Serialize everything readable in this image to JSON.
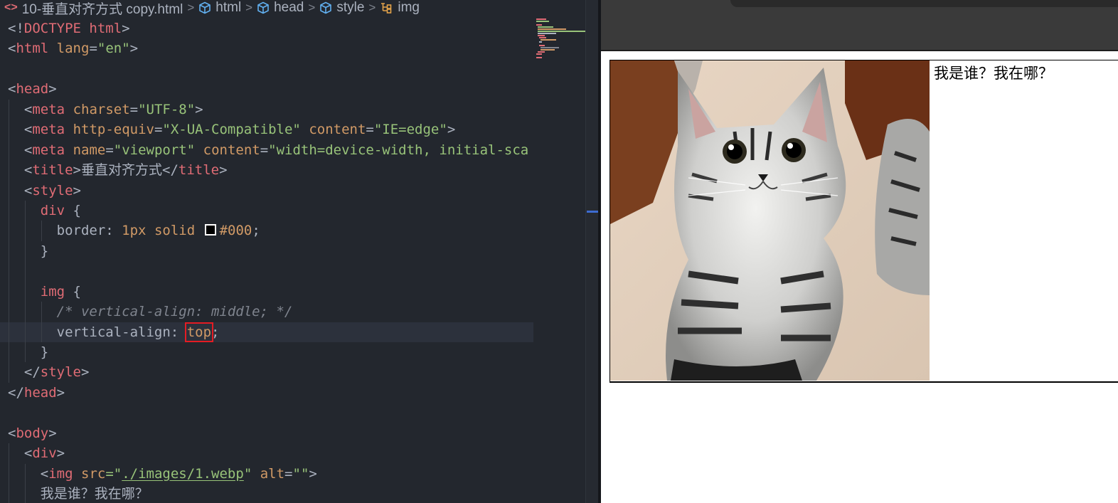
{
  "editor": {
    "breadcrumb": {
      "file_icon": "<>",
      "file": "10-垂直对齐方式 copy.html",
      "items": [
        "html",
        "head",
        "style",
        "img"
      ],
      "separator": ">"
    },
    "lines": {
      "l1": {
        "a": "<!",
        "b": "DOCTYPE",
        "c": " html",
        "d": ">"
      },
      "l2": {
        "a": "<",
        "b": "html",
        "c": "lang",
        "d": "=",
        "e": "\"en\"",
        "f": ">"
      },
      "l4": {
        "a": "<",
        "b": "head",
        "c": ">"
      },
      "l5": {
        "a": "<",
        "b": "meta",
        "c": "charset",
        "d": "=",
        "e": "\"UTF-8\"",
        "f": ">"
      },
      "l6": {
        "a": "<",
        "b": "meta",
        "c": "http-equiv",
        "d": "=",
        "e": "\"X-UA-Compatible\"",
        "f": "content",
        "g": "=",
        "h": "\"IE=edge\"",
        "i": ">"
      },
      "l7": {
        "a": "<",
        "b": "meta",
        "c": "name",
        "d": "=",
        "e": "\"viewport\"",
        "f": "content",
        "g": "=",
        "h": "\"width=device-width, initial-sca"
      },
      "l8": {
        "a": "<",
        "b": "title",
        "c": ">",
        "d": "垂直对齐方式",
        "e": "</",
        "f": "title",
        "g": ">"
      },
      "l9": {
        "a": "<",
        "b": "style",
        "c": ">"
      },
      "l10": {
        "a": "div",
        "b": " {"
      },
      "l11": {
        "a": "border",
        "b": ": ",
        "c": "1px",
        "d": " solid ",
        "e": "#000",
        "f": ";"
      },
      "l12": {
        "a": "}"
      },
      "l14": {
        "a": "img",
        "b": " {"
      },
      "l15": {
        "a": "/* vertical-align: middle; */"
      },
      "l16": {
        "a": "vertical-align",
        "b": ": ",
        "c": "top",
        "d": ";"
      },
      "l17": {
        "a": "}"
      },
      "l18": {
        "a": "</",
        "b": "style",
        "c": ">"
      },
      "l19": {
        "a": "</",
        "b": "head",
        "c": ">"
      },
      "l21": {
        "a": "<",
        "b": "body",
        "c": ">"
      },
      "l22": {
        "a": "<",
        "b": "div",
        "c": ">"
      },
      "l23": {
        "a": "<",
        "b": "img",
        "c": "src",
        "d": "=\"",
        "e": "./images/1.webp",
        "f": "\"",
        "g": "alt",
        "h": "=",
        "i": "\"\"",
        "j": ">"
      },
      "l24": {
        "a": "我是谁？我在哪？"
      }
    }
  },
  "browser": {
    "demo_text": "我是谁？我在哪？",
    "image": "cat-kitten-photo"
  },
  "colors": {
    "editor_bg": "#23272e",
    "tag": "#e06c75",
    "attr": "#d19a66",
    "string": "#98c379",
    "comment": "#7f848e",
    "highlight_box": "#e51c23"
  }
}
